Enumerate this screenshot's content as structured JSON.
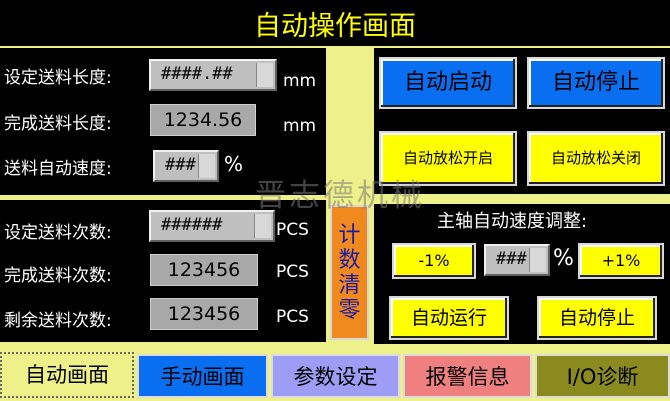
{
  "title": "自动操作画面",
  "feed": {
    "set_length_label": "设定送料长度:",
    "set_length_value": "####.##",
    "set_length_unit": "mm",
    "done_length_label": "完成送料长度:",
    "done_length_value": "1234.56",
    "done_length_unit": "mm",
    "speed_label": "送料自动速度:",
    "speed_value": "###",
    "speed_unit": "%"
  },
  "count": {
    "set_label": "设定送料次数:",
    "set_value": "######",
    "set_unit": "PCS",
    "done_label": "完成送料次数:",
    "done_value": "123456",
    "done_unit": "PCS",
    "remain_label": "剩余送料次数:",
    "remain_value": "123456",
    "remain_unit": "PCS",
    "clear_label": "计数清零"
  },
  "controls": {
    "auto_start": "自动启动",
    "auto_stop": "自动停止",
    "release_open": "自动放松开启",
    "release_close": "自动放松关闭"
  },
  "spindle": {
    "title": "主轴自动速度调整:",
    "minus": "-1%",
    "value": "###",
    "unit": "%",
    "plus": "+1%",
    "run": "自动运行",
    "stop": "自动停止"
  },
  "watermark": "晋志德机械",
  "tabs": [
    "自动画面",
    "手动画面",
    "参数设定",
    "报警信息",
    "I/O诊断"
  ],
  "colors": {
    "background": "#eef08a",
    "panel": "#000000",
    "title_text": "#ffff00",
    "button_blue": "#0a6ef0",
    "button_yellow": "#ffff00",
    "clear_orange": "#f08a1e"
  }
}
